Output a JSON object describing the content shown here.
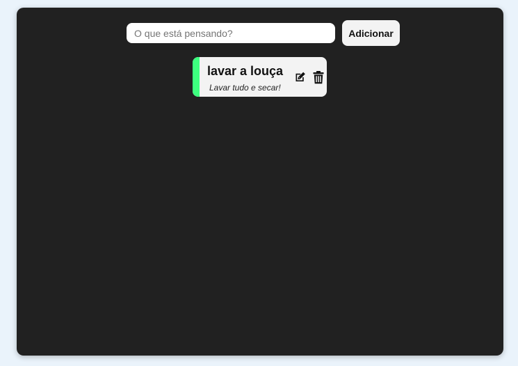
{
  "form": {
    "input_placeholder": "O que está pensando?",
    "input_value": "",
    "add_label": "Adicionar"
  },
  "tasks": [
    {
      "title": "lavar a louça",
      "description": "Lavar tudo e secar!",
      "accent_color": "#3dff7f",
      "actions": [
        "edit-icon",
        "trash-icon"
      ]
    }
  ],
  "colors": {
    "page_background": "#eaf3fb",
    "panel_background": "#212121",
    "card_background": "#f3f3f3",
    "accent": "#3dff7f"
  }
}
